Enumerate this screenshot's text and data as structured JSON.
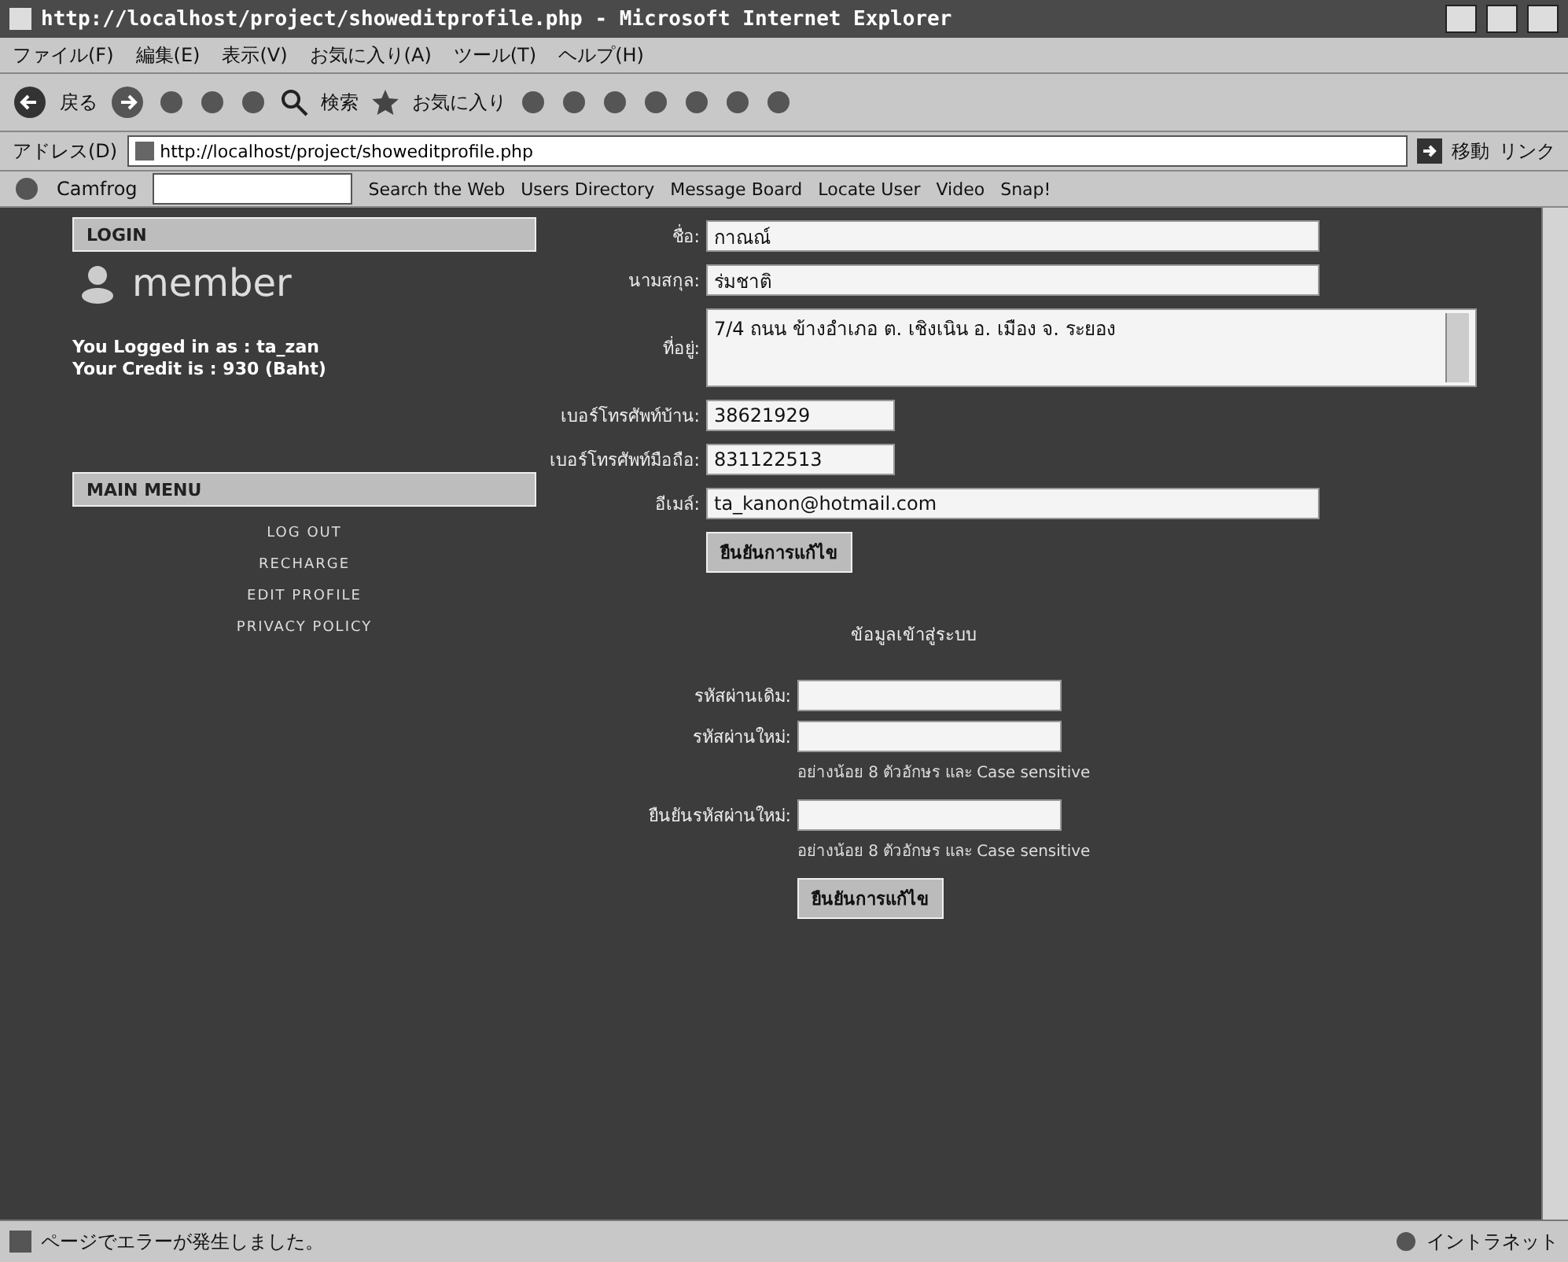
{
  "window": {
    "title": "http://localhost/project/showeditprofile.php - Microsoft Internet Explorer"
  },
  "menu_bar": [
    "ファイル(F)",
    "編集(E)",
    "表示(V)",
    "お気に入り(A)",
    "ツール(T)",
    "ヘルプ(H)"
  ],
  "toolbar": {
    "back": "戻る",
    "search": "検索",
    "favorites": "お気に入り"
  },
  "address_bar": {
    "label": "アドレス(D)",
    "value": "http://localhost/project/showeditprofile.php",
    "go": "移動",
    "links": "リンク"
  },
  "links_bar": {
    "brand": "Camfrog",
    "items": [
      "Search the Web",
      "Users Directory",
      "Message Board",
      "Locate User",
      "Video",
      "Snap!"
    ]
  },
  "sidebar": {
    "login_header": "LOGIN",
    "member_title": "member",
    "info": [
      "You Logged in as : ta_zan",
      "Your Credit is : 930 (Baht)"
    ],
    "menu_header": "MAIN MENU",
    "menu": [
      "LOG OUT",
      "RECHARGE",
      "EDIT PROFILE",
      "PRIVACY POLICY"
    ]
  },
  "profile_form": {
    "fields": [
      {
        "label": "ชื่อ:",
        "value": "กาณณ์",
        "kind": "text"
      },
      {
        "label": "นามสกุล:",
        "value": "ร่มชาติ",
        "kind": "text"
      },
      {
        "label": "ที่อยู่:",
        "value": "7/4 ถนน ข้างอำเภอ ต. เชิงเนิน อ. เมือง จ. ระยอง",
        "kind": "area"
      },
      {
        "label": "เบอร์โทรศัพท์บ้าน:",
        "value": "38621929",
        "kind": "phone"
      },
      {
        "label": "เบอร์โทรศัพท์มือถือ:",
        "value": "831122513",
        "kind": "phone"
      },
      {
        "label": "อีเมล์:",
        "value": "ta_kanon@hotmail.com",
        "kind": "text"
      }
    ],
    "submit": "ยืนยันการแก้ไข"
  },
  "password_form": {
    "title": "ข้อมูลเข้าสู่ระบบ",
    "fields": [
      {
        "label": "รหัสผ่านเดิม:"
      },
      {
        "label": "รหัสผ่านใหม่:",
        "hint": "อย่างน้อย 8 ตัวอักษร และ Case sensitive"
      },
      {
        "label": "ยืนยันรหัสผ่านใหม่:",
        "hint": "อย่างน้อย 8 ตัวอักษร และ Case sensitive"
      }
    ],
    "submit": "ยืนยันการแก้ไข"
  },
  "status_bar": {
    "message": "ページでエラーが発生しました。",
    "zone": "イントラネット"
  }
}
